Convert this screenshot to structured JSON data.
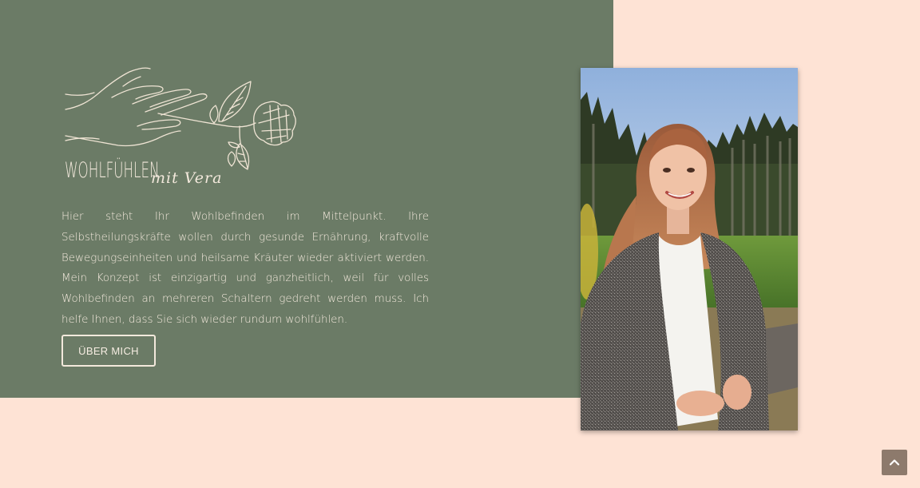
{
  "brand": {
    "name": "WOHLFÜHLEN",
    "tagline": "mit Vera"
  },
  "intro": {
    "text": "Hier steht Ihr Wohlbefinden im Mittelpunkt. Ihre Selbstheilungskräfte wollen durch gesunde Ernährung, kraftvolle Bewegungseinheiten und heilsame Kräuter wieder aktiviert werden. Mein Konzept ist einzigartig und ganzheitlich, weil für volles Wohlbefinden an mehreren Schaltern gedreht werden muss. Ich helfe Ihnen, dass Sie sich wieder rundum wohlfühlen."
  },
  "cta": {
    "label": "ÜBER MICH"
  },
  "colors": {
    "page_background": "#fee3d5",
    "panel_green": "#6b7b66",
    "cream_text": "#f3e9dc",
    "scroll_button": "#8d7a6c"
  },
  "icons": {
    "logo": "hand-holding-clover-line-art",
    "scroll_top": "chevron-up-icon"
  }
}
